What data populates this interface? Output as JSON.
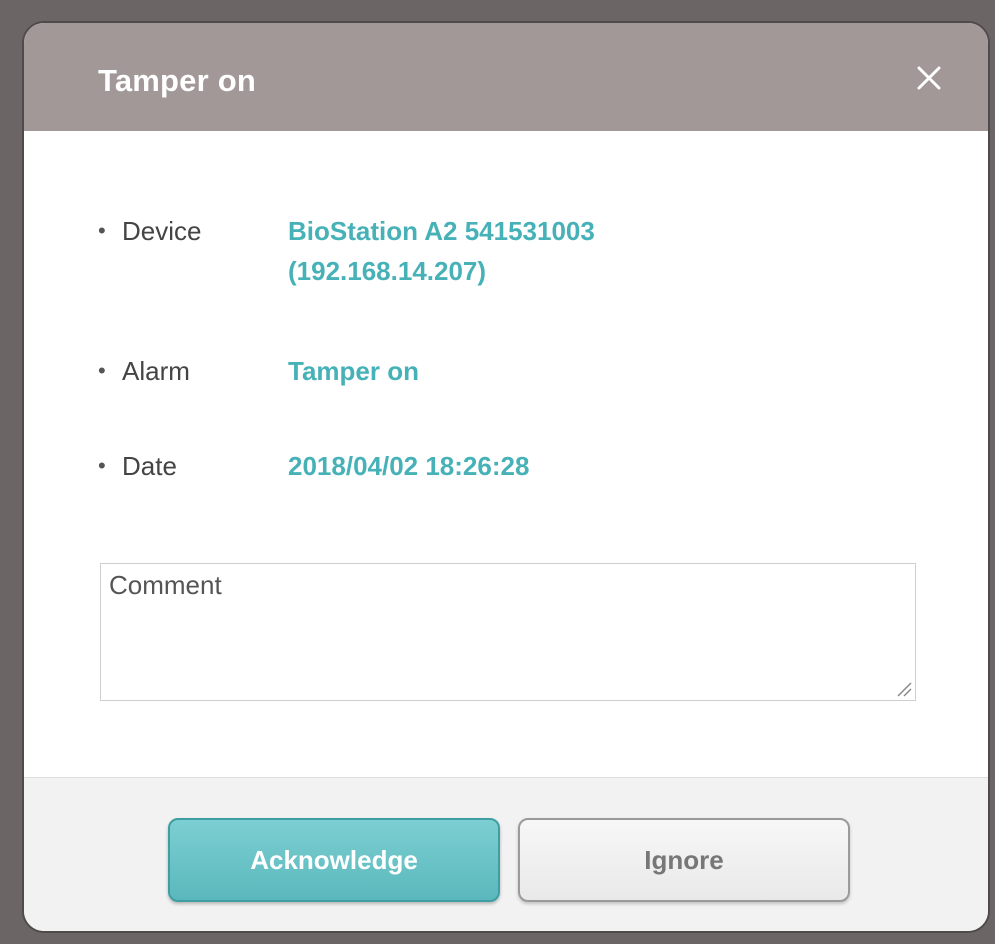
{
  "dialog": {
    "title": "Tamper on",
    "close_icon": "close-icon"
  },
  "info": {
    "bullet": "•",
    "device": {
      "label": "Device",
      "value_line1": "BioStation A2 541531003",
      "value_line2": "(192.168.14.207)"
    },
    "alarm": {
      "label": "Alarm",
      "value": "Tamper on"
    },
    "date": {
      "label": "Date",
      "value": "2018/04/02 18:26:28"
    }
  },
  "comment": {
    "placeholder": "Comment",
    "value": ""
  },
  "buttons": {
    "acknowledge": "Acknowledge",
    "ignore": "Ignore"
  },
  "colors": {
    "header": "#a29898",
    "accent": "#46b1b7",
    "ack_button": "#5ab8bc"
  }
}
